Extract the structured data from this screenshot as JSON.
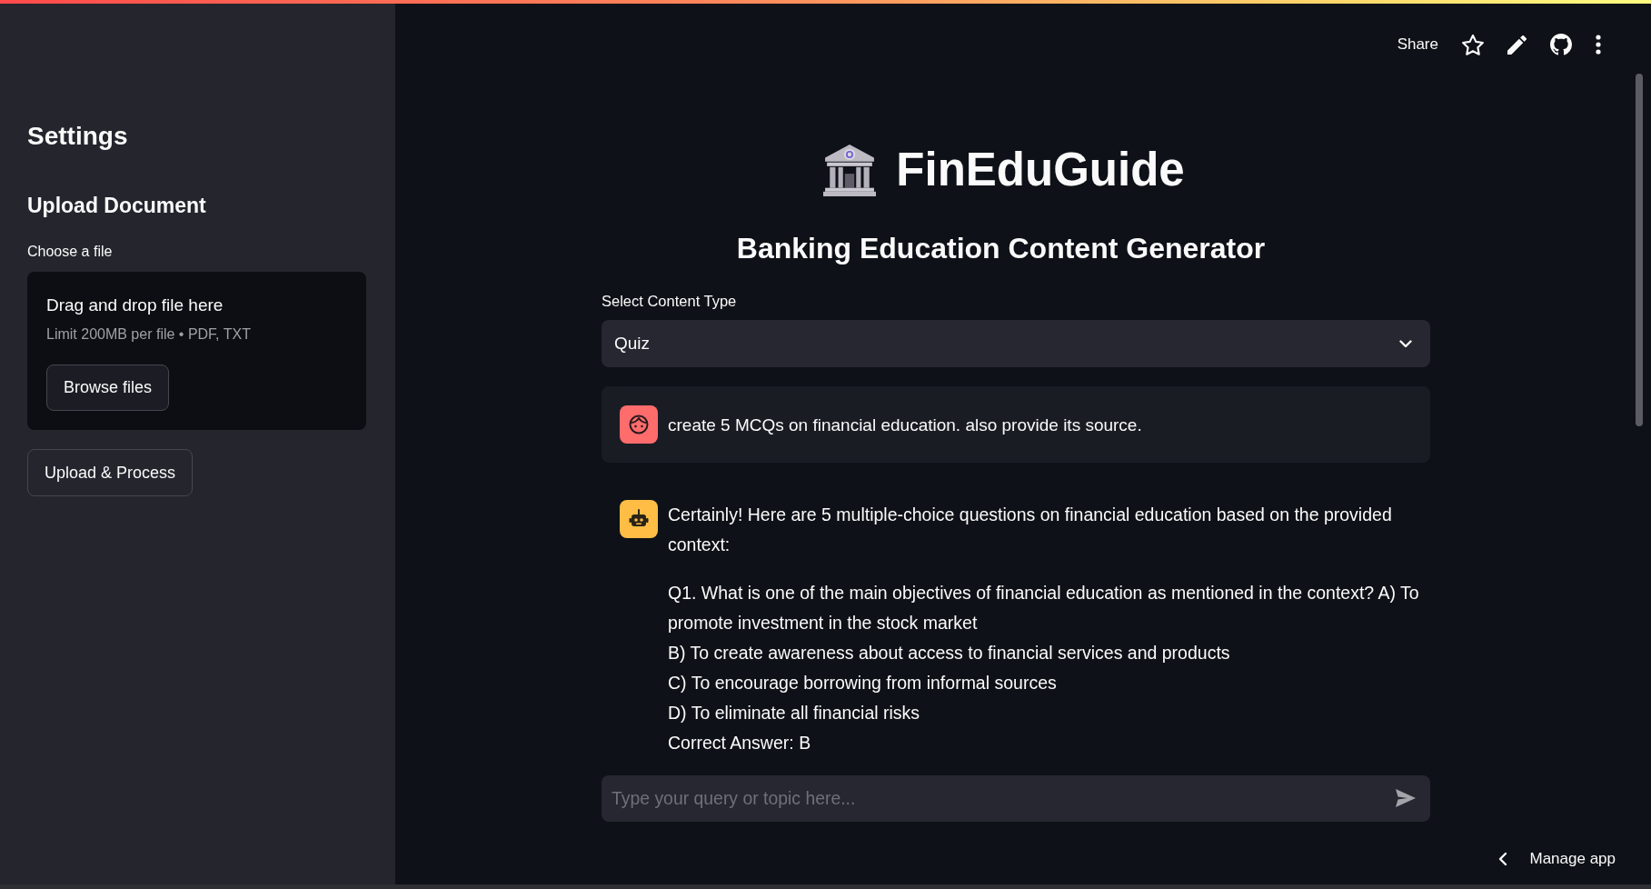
{
  "header": {
    "share_label": "Share"
  },
  "sidebar": {
    "title": "Settings",
    "section_title": "Upload Document",
    "file_uploader": {
      "label": "Choose a file",
      "dropzone_title": "Drag and drop file here",
      "dropzone_hint": "Limit 200MB per file • PDF, TXT",
      "browse_button": "Browse files"
    },
    "process_button": "Upload & Process"
  },
  "main": {
    "title": "FinEduGuide",
    "subtitle": "Banking Education Content Generator",
    "content_type": {
      "label": "Select Content Type",
      "value": "Quiz"
    },
    "messages": [
      {
        "kind": "user",
        "paragraphs": [
          [
            "create 5 MCQs on financial education. also provide its source."
          ]
        ]
      },
      {
        "kind": "assistant",
        "paragraphs": [
          [
            "Certainly! Here are 5 multiple-choice questions on financial education based on the provided context:"
          ],
          [
            "Q1. What is one of the main objectives of financial education as mentioned in the context? A) To promote investment in the stock market",
            "B) To create awareness about access to financial services and products",
            "C) To encourage borrowing from informal sources",
            "D) To eliminate all financial risks",
            "Correct Answer: B"
          ]
        ]
      }
    ],
    "chat_input": {
      "placeholder": "Type your query or topic here..."
    }
  },
  "footer": {
    "manage_app": "Manage app"
  }
}
